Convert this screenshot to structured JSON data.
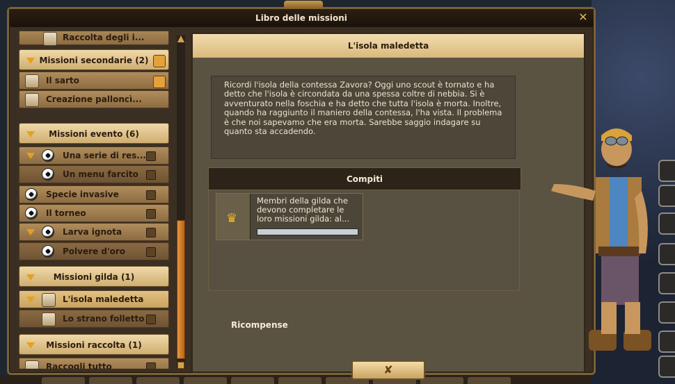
{
  "window": {
    "title": "Libro delle missioni"
  },
  "sidebar": {
    "top_partial_label": "Raccolta degli i...",
    "groups": [
      {
        "label": "Missioni secondarie (2)",
        "items": [
          "Il sarto",
          "Creazione palloncì..."
        ]
      },
      {
        "label": "Missioni evento (6)",
        "items": [
          "Una serie di res...",
          "Un menu farcito",
          "Specie invasive",
          "Il torneo",
          "Larva ignota",
          "Polvere d'oro"
        ]
      },
      {
        "label": "Missioni gilda (1)",
        "items": [
          "L'isola maledetta",
          "Lo strano folletto"
        ]
      },
      {
        "label": "Missioni raccolta (1)",
        "items": [
          "Raccogli tutto"
        ]
      }
    ]
  },
  "quest": {
    "title": "L'isola maledetta",
    "description": "Ricordi l'isola della contessa Zavora? Oggi uno scout è tornato e ha detto che l'isola è circondata da una spessa coltre di nebbia. Si è avventurato nella foschia e ha detto che tutta l'isola è morta. Inoltre, quando ha raggiunto il maniero della contessa, l'ha vista. Il problema è che noi sapevamo che era morta. Sarebbe saggio indagare su quanto sta accadendo.",
    "tasks_header": "Compiti",
    "task_text": "Membri della gilda che devono completare le loro missioni gilda: al...",
    "task_progress": 0.0,
    "rewards_header": "Ricompense",
    "ok_icon": "✘"
  },
  "icons": {
    "close": "✕",
    "crown": "♛"
  },
  "colors": {
    "accent": "#e3a11e",
    "progress": "#3a8fd8"
  }
}
